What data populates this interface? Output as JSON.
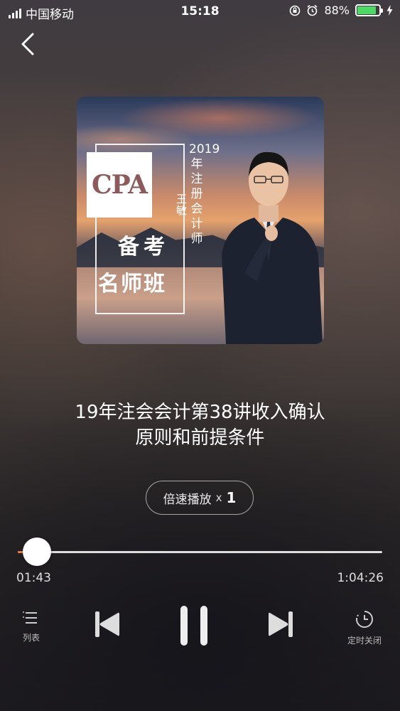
{
  "status_bar": {
    "carrier": "中国移动",
    "time": "15:18",
    "battery_percent": "88%",
    "battery_level": 0.88
  },
  "cover": {
    "cpa": "CPA",
    "teacher": "王敏",
    "line1": "备考",
    "line2": "名师班",
    "vertical": "2019年注册会计师"
  },
  "track": {
    "title_line1": "19年注会会计第38讲收入确认",
    "title_line2": "原则和前提条件"
  },
  "speed": {
    "label": "倍速播放",
    "x": "x",
    "value": "1"
  },
  "progress": {
    "current": "01:43",
    "total": "1:04:26",
    "fraction": 0.0266
  },
  "controls": {
    "list_label": "列表",
    "timer_label": "定时关闭"
  },
  "colors": {
    "accent": "#f07a3a",
    "battery": "#4cd964"
  }
}
